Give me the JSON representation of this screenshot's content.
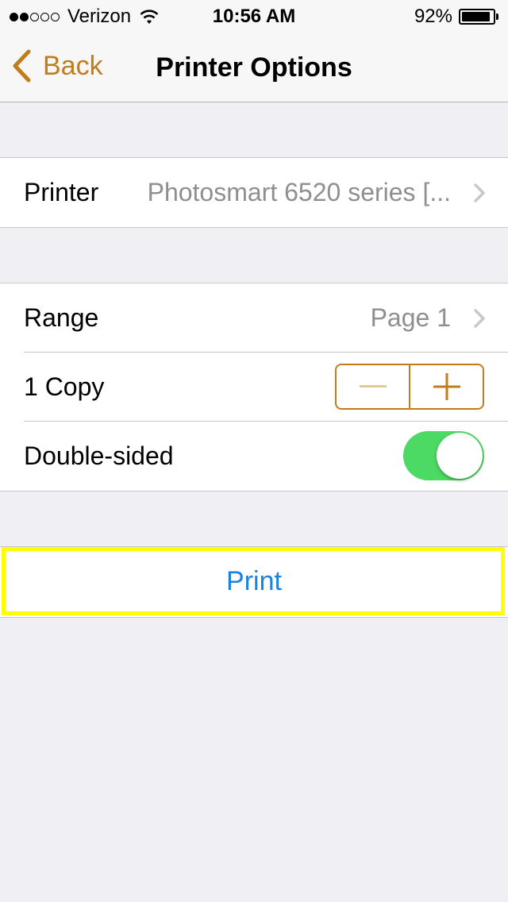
{
  "status_bar": {
    "signal_bars_filled": 2,
    "signal_bars_total": 5,
    "carrier": "Verizon",
    "icon_wifi": "wifi-icon",
    "time": "10:56 AM",
    "battery_percent_label": "92%",
    "battery_level": 0.92
  },
  "nav": {
    "back_label": "Back",
    "title": "Printer Options",
    "accent_color": "#c17d1c"
  },
  "printer_group": {
    "label": "Printer",
    "value": "Photosmart 6520 series [..."
  },
  "options": {
    "range_label": "Range",
    "range_value": "Page 1",
    "copies_label": "1 Copy",
    "copies": 1,
    "stepper_minus": "minus-icon",
    "stepper_plus": "plus-icon",
    "double_sided_label": "Double-sided",
    "double_sided_on": true,
    "toggle_color": "#4cd964"
  },
  "print_button": {
    "label": "Print",
    "color": "#1a82e2",
    "highlight_color": "#ffff00"
  }
}
